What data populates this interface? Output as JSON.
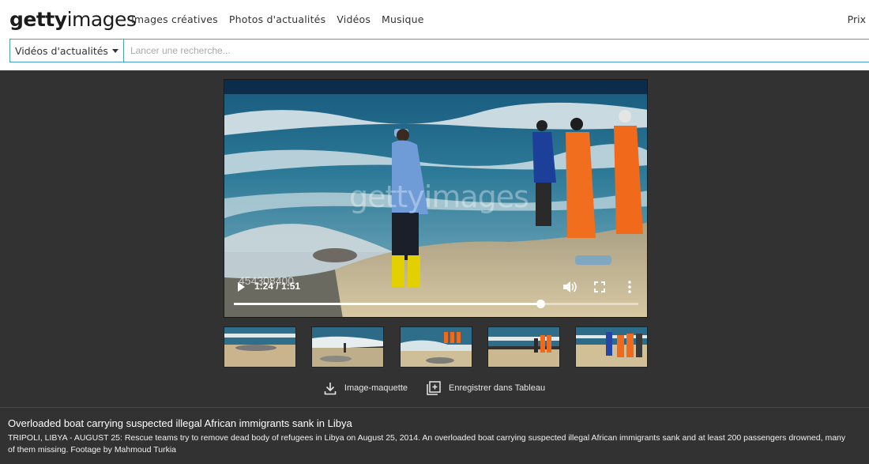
{
  "header": {
    "logo_bold": "getty",
    "logo_light": "images",
    "nav": [
      "Images créatives",
      "Photos d'actualités",
      "Vidéos",
      "Musique"
    ],
    "pricing_label": "Prix"
  },
  "search": {
    "category": "Vidéos d'actualités",
    "placeholder": "Lancer une recherche..."
  },
  "player": {
    "watermark": "gettyimages",
    "asset_id": "454308400",
    "current_time": "1:24",
    "duration": "1:51",
    "time_display": "1:24 / 1:51",
    "progress_fraction": 0.757,
    "icons": [
      "play-icon",
      "volume-icon",
      "fullscreen-icon",
      "more-options-icon"
    ]
  },
  "thumbnails": [
    {
      "label": "thumbnail-1"
    },
    {
      "label": "thumbnail-2"
    },
    {
      "label": "thumbnail-3"
    },
    {
      "label": "thumbnail-4"
    },
    {
      "label": "thumbnail-5"
    }
  ],
  "actions": {
    "mockup_label": "Image-maquette",
    "save_label": "Enregistrer dans Tableau"
  },
  "caption": {
    "title": "Overloaded boat carrying suspected illegal African immigrants sank in Libya",
    "description": "TRIPOLI, LIBYA - AUGUST 25: Rescue teams try to remove dead body of refugees in Libya on August 25, 2014. An overloaded boat carrying suspected illegal African immigrants sank and at least 200 passengers drowned, many of them missing. Footage by Mahmoud Turkia"
  },
  "colors": {
    "header_bg": "#ffffff",
    "page_bg": "#323232",
    "search_border": "#45a0c9"
  }
}
